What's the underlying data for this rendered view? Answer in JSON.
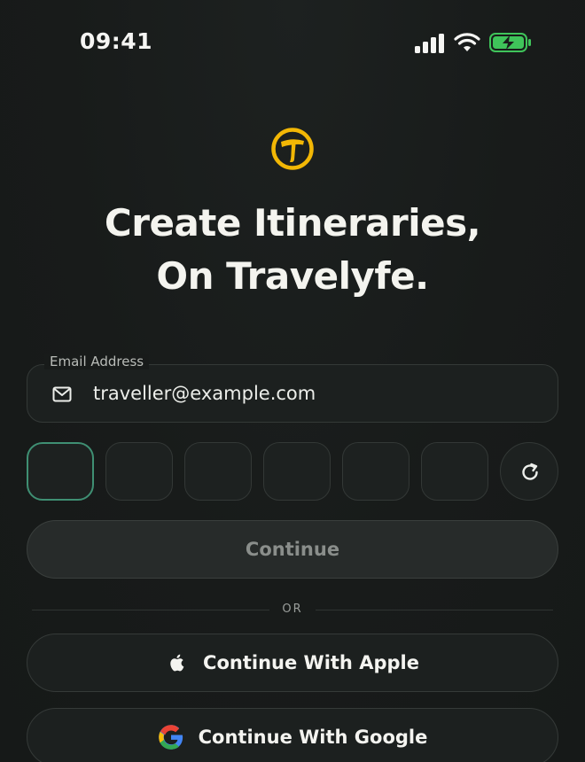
{
  "status_bar": {
    "time": "09:41",
    "battery_color": "#3fc45a"
  },
  "brand": {
    "logo_icon": "travelyfe-logo-icon",
    "accent_color": "#f2b705"
  },
  "headline": {
    "line1": "Create Itineraries,",
    "line2": "On Travelyfe."
  },
  "email": {
    "label": "Email Address",
    "value": "traveller@example.com",
    "icon": "mail-icon"
  },
  "code": {
    "box_count": 6,
    "active_index": 0,
    "active_color": "#3f8f73",
    "refresh_icon": "refresh-icon"
  },
  "continue_button": {
    "label": "Continue"
  },
  "divider": {
    "label": "OR"
  },
  "social": {
    "apple_label": "Continue With Apple",
    "google_label": "Continue With Google"
  }
}
